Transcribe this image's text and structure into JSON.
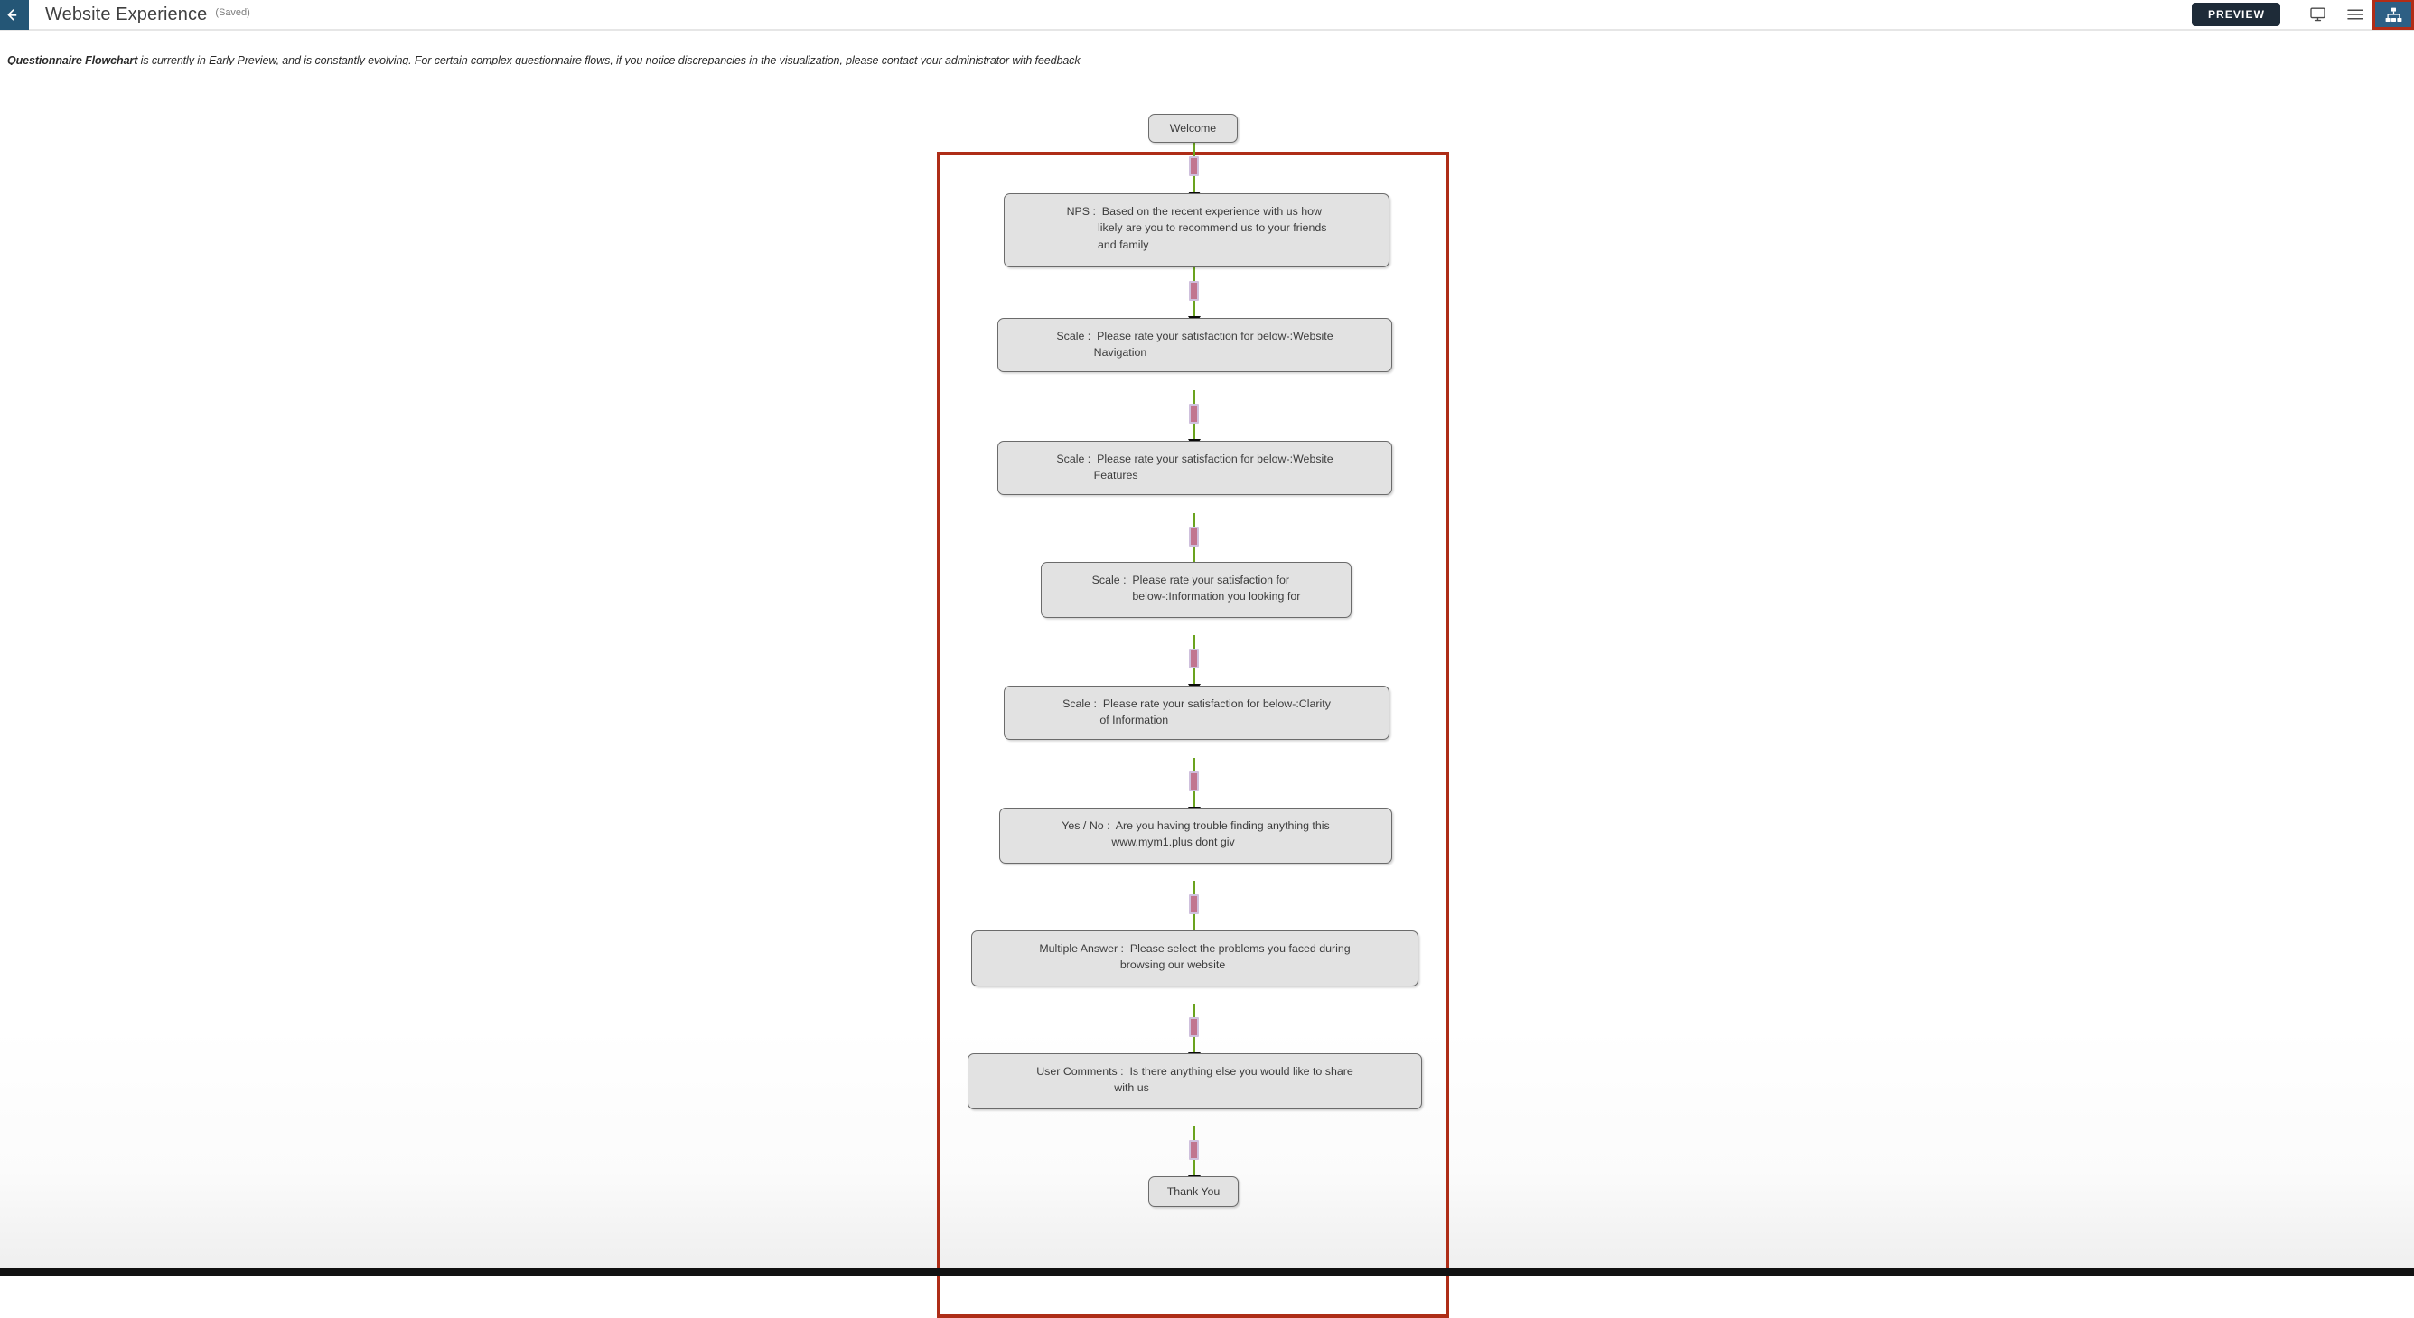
{
  "appbar": {
    "back_icon": "arrow-left-icon",
    "title": "Website Experience",
    "saved_label": "(Saved)",
    "preview_label": "PREVIEW",
    "monitor_icon": "monitor-icon",
    "list_icon": "hamburger-menu-icon",
    "flowchart_icon": "sitemap-icon",
    "accent_navy": "#245676",
    "accent_active": "#2d5f84",
    "highlight_red": "#b22d17",
    "preview_bg": "#1e2b38"
  },
  "notice": {
    "bold_prefix": "Questionnaire Flowchart",
    "rest": " is currently in Early Preview, and is constantly evolving. For certain complex questionnaire flows, if you notice discrepancies in the visualization, please contact your administrator with feedback"
  },
  "flowchart": {
    "frame_border_color": "#ae2d17",
    "node_fill": "#e2e2e2",
    "node_border": "#6b6b6b",
    "edge_color": "#6aa31e",
    "edge_marker_fill": "#c1758f",
    "edge_marker_border": "#cfc0dd",
    "arrow_color": "#0a0a0a",
    "nodes": [
      {
        "id": "welcome",
        "label": "Welcome"
      },
      {
        "id": "nps",
        "label": "NPS :  Based on the recent experience with us how\n          likely are you to recommend us to your friends\n          and family"
      },
      {
        "id": "scale-nav",
        "label": "Scale :  Please rate your satisfaction for below-:Website\n            Navigation"
      },
      {
        "id": "scale-feat",
        "label": "Scale :  Please rate your satisfaction for below-:Website\n            Features"
      },
      {
        "id": "scale-info",
        "label": "Scale :  Please rate your satisfaction for\n             below-:Information you looking for"
      },
      {
        "id": "scale-clar",
        "label": "Scale :  Please rate your satisfaction for below-:Clarity\n            of Information"
      },
      {
        "id": "yesno",
        "label": "Yes / No :  Are you having trouble finding anything this\n                www.mym1.plus dont giv"
      },
      {
        "id": "multiple",
        "label": "Multiple Answer :  Please select the problems you faced during\n                          browsing our website"
      },
      {
        "id": "comments",
        "label": "User Comments :  Is there anything else you would like to share\n                         with us"
      },
      {
        "id": "thankyou",
        "label": "Thank You"
      }
    ]
  }
}
